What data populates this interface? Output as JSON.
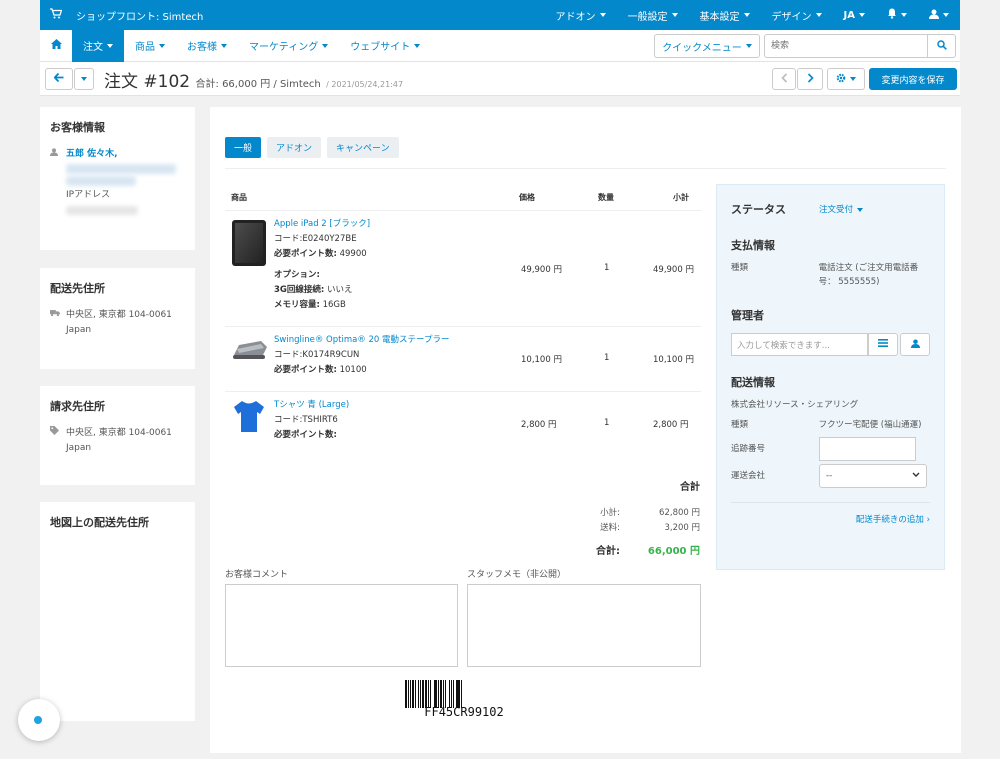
{
  "topbar": {
    "store": "ショップフロント: Simtech",
    "menus": [
      "アドオン",
      "一般設定",
      "基本設定",
      "デザイン",
      "JA"
    ]
  },
  "nav": {
    "items": [
      "注文",
      "商品",
      "お客様",
      "マーケティング",
      "ウェブサイト"
    ],
    "quick_menu": "クイックメニュー",
    "search_placeholder": "検索"
  },
  "header": {
    "title": "注文 #102",
    "subtitle": "合計: 66,000 円 / Simtech",
    "date": "/ 2021/05/24,21:47",
    "save": "変更内容を保存"
  },
  "sidebar": {
    "customer": {
      "title": "お客様情報",
      "name": "五郎 佐々木,",
      "ip_label": "IPアドレス"
    },
    "shipping": {
      "title": "配送先住所",
      "address": "中央区, 東京都 104-0061",
      "country": "Japan"
    },
    "billing": {
      "title": "請求先住所",
      "address": "中央区, 東京都 104-0061",
      "country": "Japan"
    },
    "map": {
      "title": "地図上の配送先住所"
    }
  },
  "tabs": [
    "一般",
    "アドオン",
    "キャンペーン"
  ],
  "table": {
    "headers": {
      "product": "商品",
      "price": "価格",
      "qty": "数量",
      "subtotal": "小計"
    },
    "rows": [
      {
        "name": "Apple iPad 2 [ブラック]",
        "code": "コード:E0240Y27BE",
        "points_label": "必要ポイント数:",
        "points": "49900",
        "options_label": "オプション:",
        "opt1_label": "3G回線接続:",
        "opt1": "いいえ",
        "opt2_label": "メモリ容量:",
        "opt2": "16GB",
        "price": "49,900 円",
        "qty": "1",
        "subtotal": "49,900 円"
      },
      {
        "name": "Swingline® Optima® 20 電動ステープラー",
        "code": "コード:K0174R9CUN",
        "points_label": "必要ポイント数:",
        "points": "10100",
        "price": "10,100 円",
        "qty": "1",
        "subtotal": "10,100 円"
      },
      {
        "name": "Tシャツ 青 (Large)",
        "code": "コード:TSHIRT6",
        "points_label": "必要ポイント数:",
        "points": "",
        "price": "2,800 円",
        "qty": "1",
        "subtotal": "2,800 円"
      }
    ]
  },
  "totals": {
    "title": "合計",
    "subtotal_label": "小計:",
    "subtotal": "62,800 円",
    "shipping_label": "送料:",
    "shipping": "3,200 円",
    "total_label": "合計:",
    "total": "66,000 円"
  },
  "panel": {
    "status_label": "ステータス",
    "status": "注文受付",
    "payment_title": "支払情報",
    "payment_type_label": "種類",
    "payment_type": "電話注文 (ご注文用電話番号： 5555555)",
    "manager_title": "管理者",
    "manager_placeholder": "入力して検索できます...",
    "shipping_title": "配送情報",
    "company": "株式会社リソース・シェアリング",
    "ship_type_label": "種類",
    "ship_type": "フクツー宅配便 (福山通運)",
    "tracking_label": "追跡番号",
    "carrier_label": "運送会社",
    "carrier_value": "--",
    "add_shipment": "配送手続きの追加"
  },
  "comments": {
    "customer_label": "お客様コメント",
    "staff_label": "スタッフメモ（非公開）"
  },
  "barcode": "FF45CR99102",
  "colors": {
    "primary": "#0388cc",
    "total_green": "#36b34a"
  }
}
